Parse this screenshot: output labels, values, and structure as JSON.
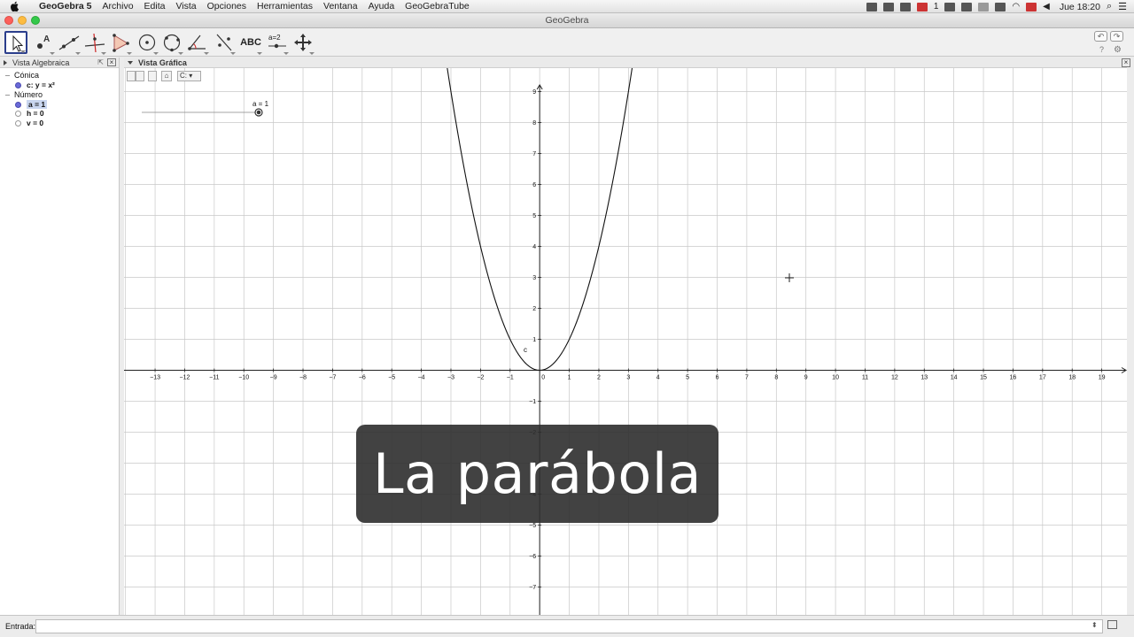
{
  "menubar": {
    "app_name": "GeoGebra 5",
    "items": [
      "Archivo",
      "Edita",
      "Vista",
      "Opciones",
      "Herramientas",
      "Ventana",
      "Ayuda",
      "GeoGebraTube"
    ],
    "mail_count": "1",
    "clock": "Jue 18:20"
  },
  "window": {
    "title": "GeoGebra"
  },
  "toolbar": {
    "text_tool_label": "ABC",
    "slider_tool_label": "a=2",
    "tools": [
      "move-tool",
      "point-tool",
      "line-tool",
      "perpendicular-tool",
      "polygon-tool",
      "circle-tool",
      "conic-tool",
      "angle-tool",
      "reflect-tool",
      "text-tool",
      "slider-tool",
      "move-view-tool"
    ],
    "help_label": "?"
  },
  "algebra_view": {
    "title": "Vista Algebraica",
    "groups": [
      {
        "label": "Cónica",
        "items": [
          {
            "text": "c: y = x²",
            "visible": true,
            "selected": false
          }
        ]
      },
      {
        "label": "Número",
        "items": [
          {
            "text": "a = 1",
            "visible": true,
            "selected": true
          },
          {
            "text": "h = 0",
            "visible": false,
            "selected": false
          },
          {
            "text": "v = 0",
            "visible": false,
            "selected": false
          }
        ]
      }
    ]
  },
  "graphics_view": {
    "title": "Vista Gráfica",
    "style_bar": {
      "point_capture": "C:"
    },
    "slider": {
      "label": "a = 1",
      "value": 1
    },
    "curve_label": "c"
  },
  "chart_data": {
    "type": "line",
    "title": "",
    "xlabel": "",
    "ylabel": "",
    "function": "y = x^2",
    "series": [
      {
        "name": "c",
        "x": [
          -3.2,
          -3,
          -2.5,
          -2,
          -1.5,
          -1,
          -0.5,
          0,
          0.5,
          1,
          1.5,
          2,
          2.5,
          3,
          3.2
        ],
        "y": [
          10.24,
          9,
          6.25,
          4,
          2.25,
          1,
          0.25,
          0,
          0.25,
          1,
          2.25,
          4,
          6.25,
          9,
          10.24
        ]
      }
    ],
    "xlim": [
      -14.05,
      19.85
    ],
    "ylim": [
      -7.9,
      10.1
    ],
    "x_ticks": [
      -13,
      -12,
      -11,
      -10,
      -9,
      -8,
      -7,
      -6,
      -5,
      -4,
      -3,
      -2,
      -1,
      0,
      1,
      2,
      3,
      4,
      5,
      6,
      7,
      8,
      9,
      10,
      11,
      12,
      13,
      14,
      15,
      16,
      17,
      18,
      19
    ],
    "y_ticks": [
      -7,
      -6,
      -5,
      -4,
      -3,
      -2,
      -1,
      0,
      1,
      2,
      3,
      4,
      5,
      6,
      7,
      8,
      9
    ],
    "grid": true
  },
  "input_bar": {
    "label": "Entrada:",
    "value": "",
    "arrows": "⬍"
  },
  "caption": {
    "text": "La parábola"
  }
}
